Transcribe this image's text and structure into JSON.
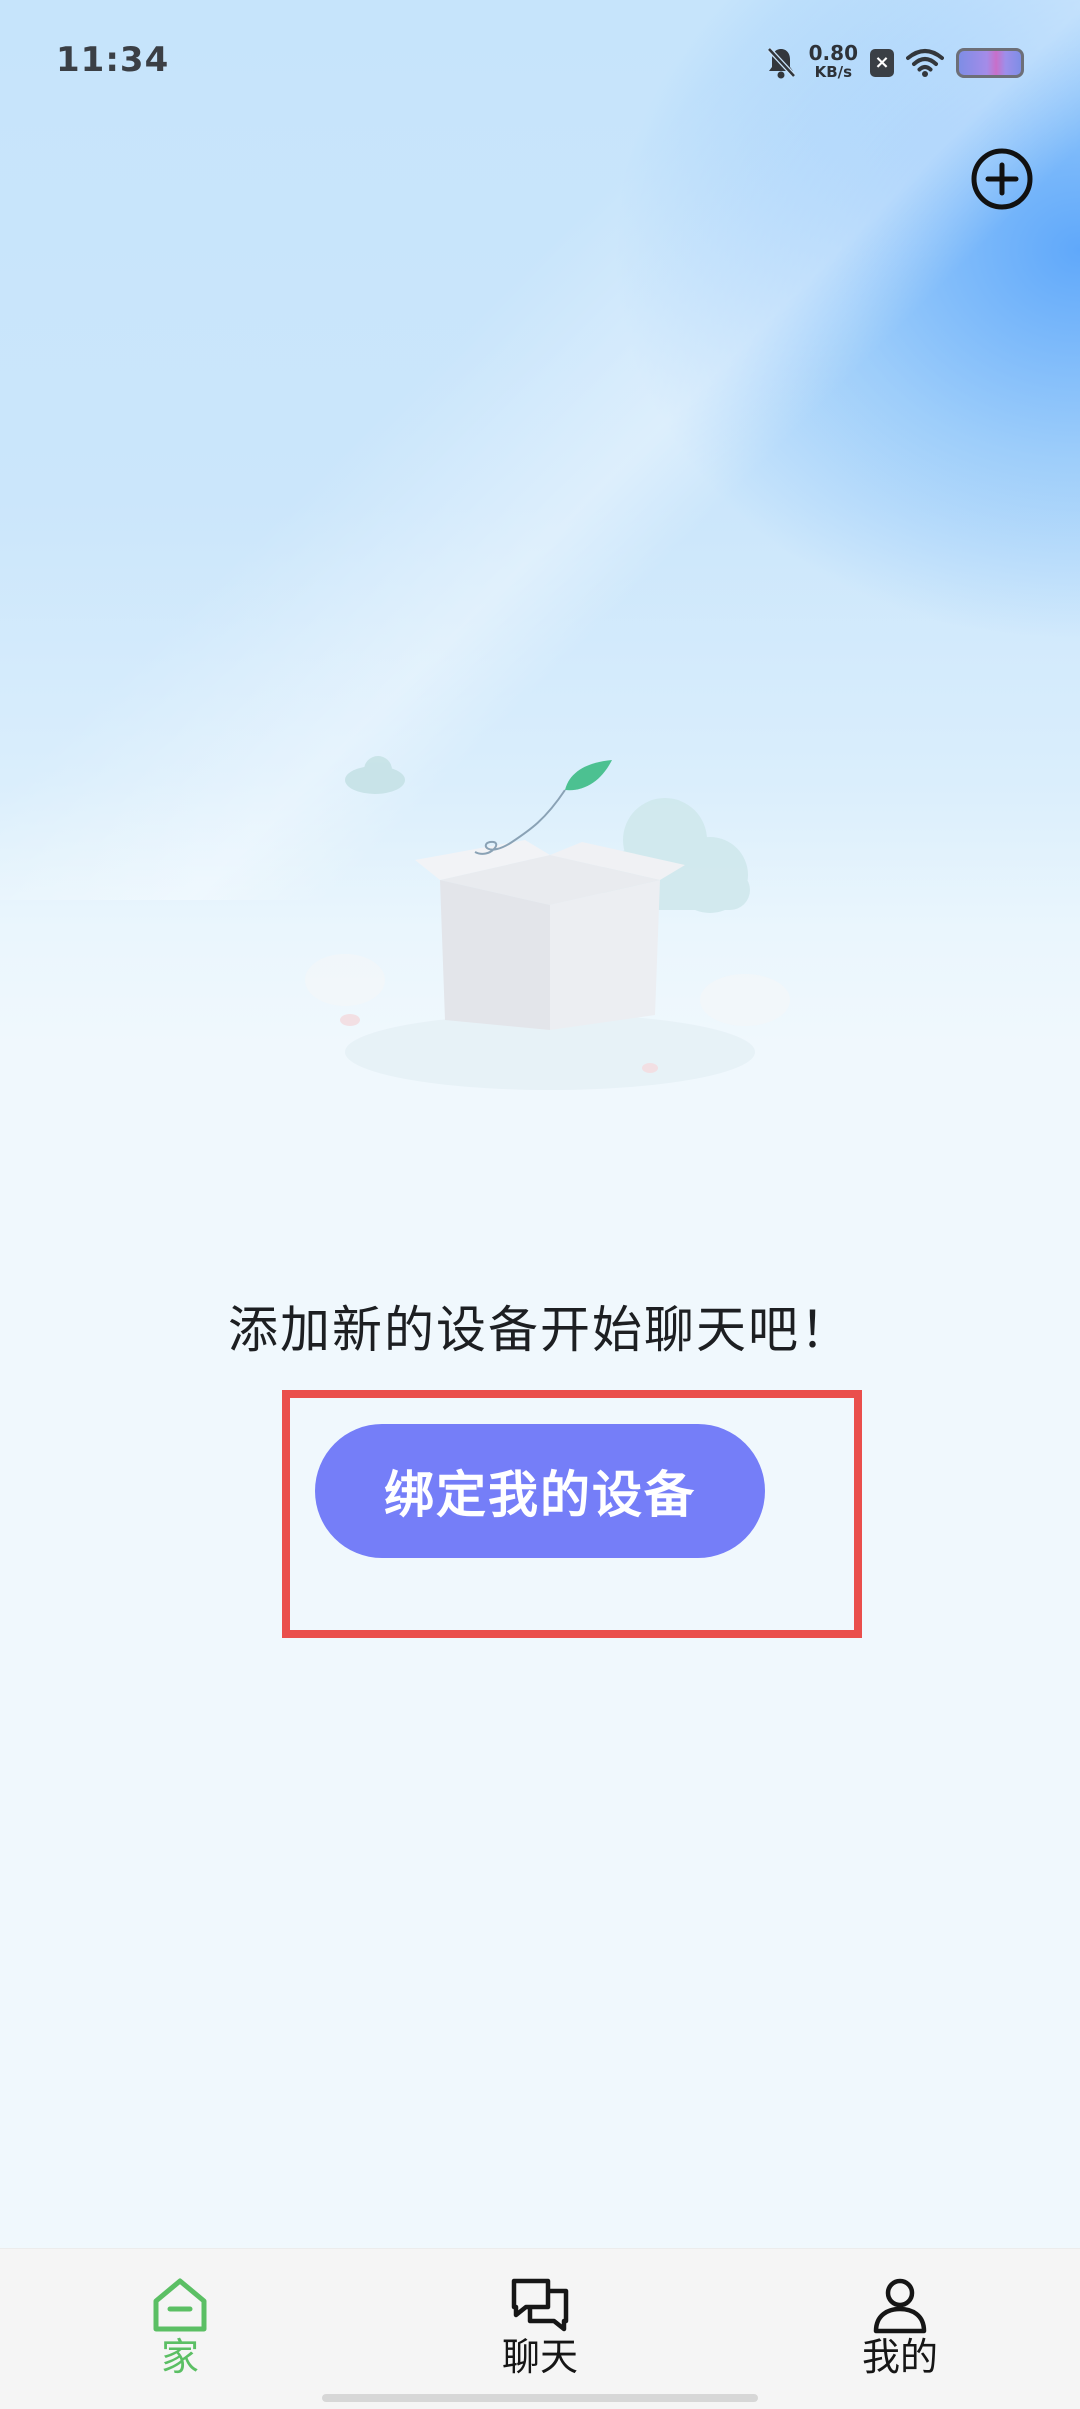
{
  "status_bar": {
    "time": "11:34",
    "net_speed_value": "0.80",
    "net_speed_unit": "KB/s",
    "sim_badge": "×",
    "icons": [
      "bell-muted-icon",
      "sim-x-icon",
      "wifi-icon",
      "battery-icon"
    ]
  },
  "header": {
    "add_icon": "plus-circle-icon"
  },
  "empty_state": {
    "illustration": "empty-box-illustration",
    "message": "添加新的设备开始聊天吧！",
    "bind_button_label": "绑定我的设备"
  },
  "colors": {
    "accent": "#757ef8",
    "highlight_border": "#ea4f4c",
    "nav_active": "#5bbf64",
    "nav_inactive": "#161616"
  },
  "bottom_nav": {
    "items": [
      {
        "label": "家",
        "icon": "home-icon",
        "active": true
      },
      {
        "label": "聊天",
        "icon": "chat-icon",
        "active": false
      },
      {
        "label": "我的",
        "icon": "user-icon",
        "active": false
      }
    ]
  }
}
